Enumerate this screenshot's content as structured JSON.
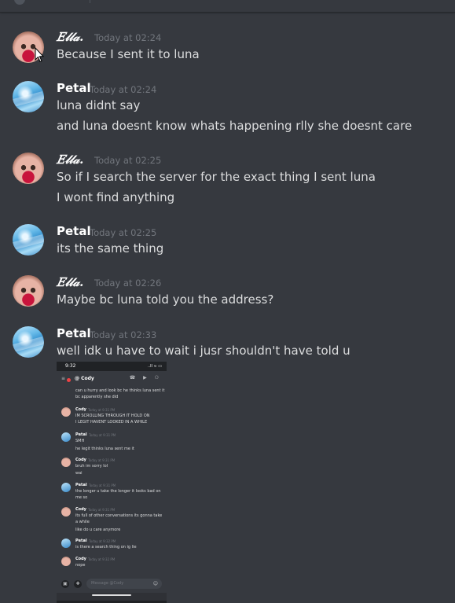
{
  "messages": [
    {
      "author": "𝐸𝓁𝓁𝒶.",
      "timestamp": "Today at 02:24",
      "avatar": "ella-avatar",
      "lines": [
        "Because I sent it to luna"
      ]
    },
    {
      "author": "Petal",
      "timestamp": "Today at 02:24",
      "avatar": "petal-avatar",
      "lines": [
        "luna didnt say",
        "and luna doesnt know whats happening rlly she doesnt care"
      ]
    },
    {
      "author": "𝐸𝓁𝓁𝒶.",
      "timestamp": "Today at 02:25",
      "avatar": "ella-avatar",
      "lines": [
        "So if I search the server for the exact thing I sent luna",
        "I wont find anything"
      ]
    },
    {
      "author": "Petal",
      "timestamp": "Today at 02:25",
      "avatar": "petal-avatar",
      "lines": [
        "its the same thing"
      ]
    },
    {
      "author": "𝐸𝓁𝓁𝒶.",
      "timestamp": "Today at 02:26",
      "avatar": "ella-avatar",
      "lines": [
        "Maybe bc luna told you the address?"
      ]
    },
    {
      "author": "Petal",
      "timestamp": "Today at 02:33",
      "avatar": "petal-avatar",
      "lines": [
        "well idk u have to wait  i jusr shouldn't have told u"
      ]
    }
  ],
  "attachment": {
    "status_time": "9:32",
    "status_icons": "..ll ≈ ▭",
    "menu_icon": "≡",
    "channel": "@ Cody",
    "header_icons": "☎ ▶ ⚇",
    "messages": [
      {
        "author": "",
        "timestamp": "",
        "lines": [
          "can u hurry and look bc he thinks luna sent it",
          "bc apparently she did"
        ]
      },
      {
        "author": "Cody",
        "timestamp": "Today at 9:31 PM",
        "lines": [
          "IM SCROLLING THROUGH IT HOLD ON",
          "I LEGIT HAVENT LOOKED IN A WHILE"
        ]
      },
      {
        "author": "Petal",
        "timestamp": "Today at 9:31 PM",
        "lines": [
          "SMH",
          "he legit thinks luna sent me it"
        ]
      },
      {
        "author": "Cody",
        "timestamp": "Today at 9:31 PM",
        "lines": [
          "bruh im sorry lol",
          "wai"
        ]
      },
      {
        "author": "Petal",
        "timestamp": "Today at 9:31 PM",
        "lines": [
          "the longer u take the longer it looks bad on",
          "me so"
        ]
      },
      {
        "author": "Cody",
        "timestamp": "Today at 9:31 PM",
        "lines": [
          "its full of other conversations its gonna take",
          "a while",
          "like do u care anymore"
        ]
      },
      {
        "author": "Petal",
        "timestamp": "Today at 9:32 PM",
        "lines": [
          "is there a search thing on ig lie"
        ]
      },
      {
        "author": "Cody",
        "timestamp": "Today at 9:32 PM",
        "lines": [
          "nope"
        ]
      }
    ],
    "input_placeholder": "Message @Cody",
    "input_icons": {
      "image": "▣",
      "gift": "✚",
      "emoji": "☺"
    }
  }
}
